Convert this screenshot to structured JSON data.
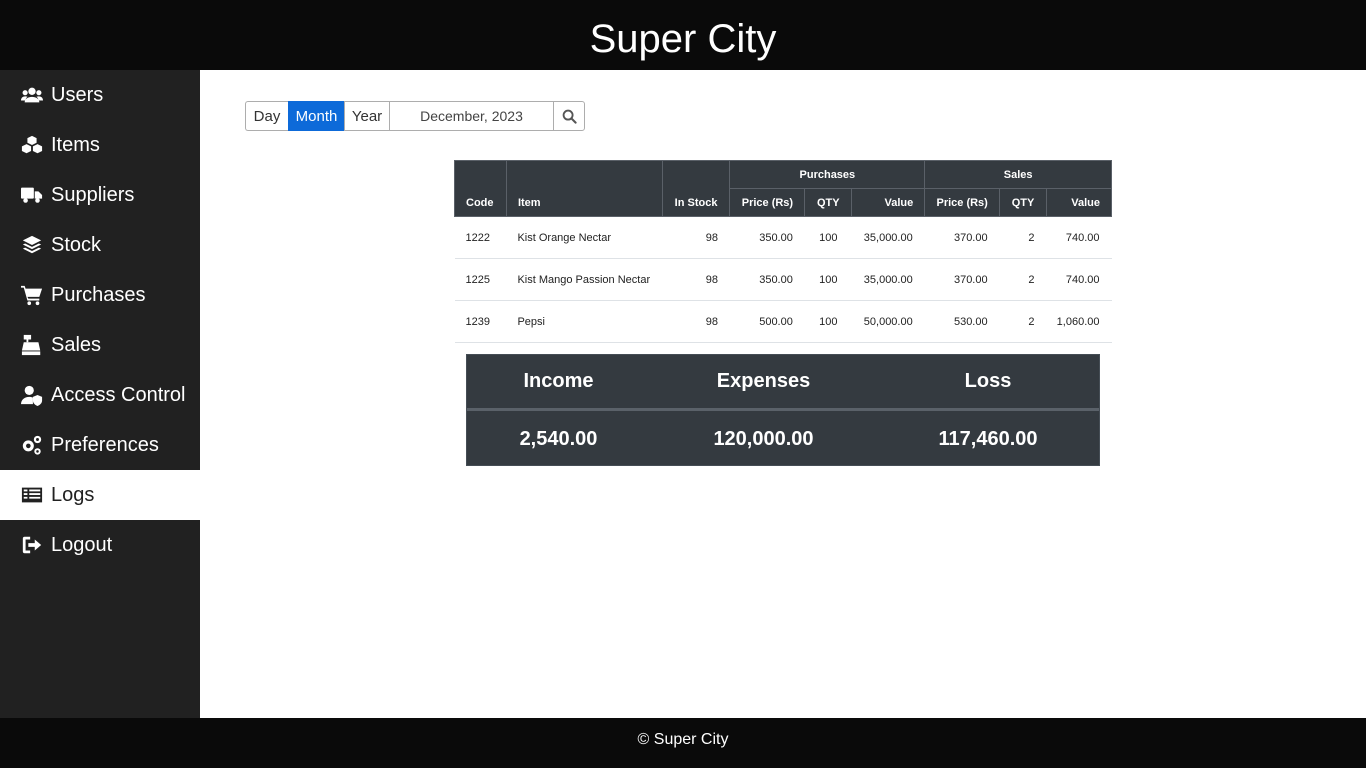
{
  "app": {
    "title": "Super City",
    "footer": "© Super City"
  },
  "sidebar": {
    "items": [
      {
        "label": "Users",
        "icon": "users-icon"
      },
      {
        "label": "Items",
        "icon": "cubes-icon"
      },
      {
        "label": "Suppliers",
        "icon": "truck-icon"
      },
      {
        "label": "Stock",
        "icon": "layers-icon"
      },
      {
        "label": "Purchases",
        "icon": "cart-icon"
      },
      {
        "label": "Sales",
        "icon": "cash-register-icon"
      },
      {
        "label": "Access Control",
        "icon": "user-shield-icon"
      },
      {
        "label": "Preferences",
        "icon": "gears-icon"
      },
      {
        "label": "Logs",
        "icon": "list-icon",
        "active": true
      },
      {
        "label": "Logout",
        "icon": "logout-icon"
      }
    ]
  },
  "filter": {
    "day_label": "Day",
    "month_label": "Month",
    "year_label": "Year",
    "selected": "Month",
    "date_value": "December, 2023",
    "search_icon": "search-icon",
    "accent_color": "#0d6ad9"
  },
  "table": {
    "headers": {
      "code": "Code",
      "item": "Item",
      "in_stock": "In Stock",
      "purchases": "Purchases",
      "sales": "Sales",
      "price": "Price (Rs)",
      "qty": "QTY",
      "value": "Value"
    },
    "rows": [
      {
        "code": "1222",
        "item": "Kist Orange Nectar",
        "in_stock": "98",
        "p_price": "350.00",
        "p_qty": "100",
        "p_value": "35,000.00",
        "s_price": "370.00",
        "s_qty": "2",
        "s_value": "740.00"
      },
      {
        "code": "1225",
        "item": "Kist Mango Passion Nectar",
        "in_stock": "98",
        "p_price": "350.00",
        "p_qty": "100",
        "p_value": "35,000.00",
        "s_price": "370.00",
        "s_qty": "2",
        "s_value": "740.00"
      },
      {
        "code": "1239",
        "item": "Pepsi",
        "in_stock": "98",
        "p_price": "500.00",
        "p_qty": "100",
        "p_value": "50,000.00",
        "s_price": "530.00",
        "s_qty": "2",
        "s_value": "1,060.00"
      }
    ]
  },
  "summary": {
    "income_label": "Income",
    "expenses_label": "Expenses",
    "loss_label": "Loss",
    "income": "2,540.00",
    "expenses": "120,000.00",
    "loss": "117,460.00"
  }
}
